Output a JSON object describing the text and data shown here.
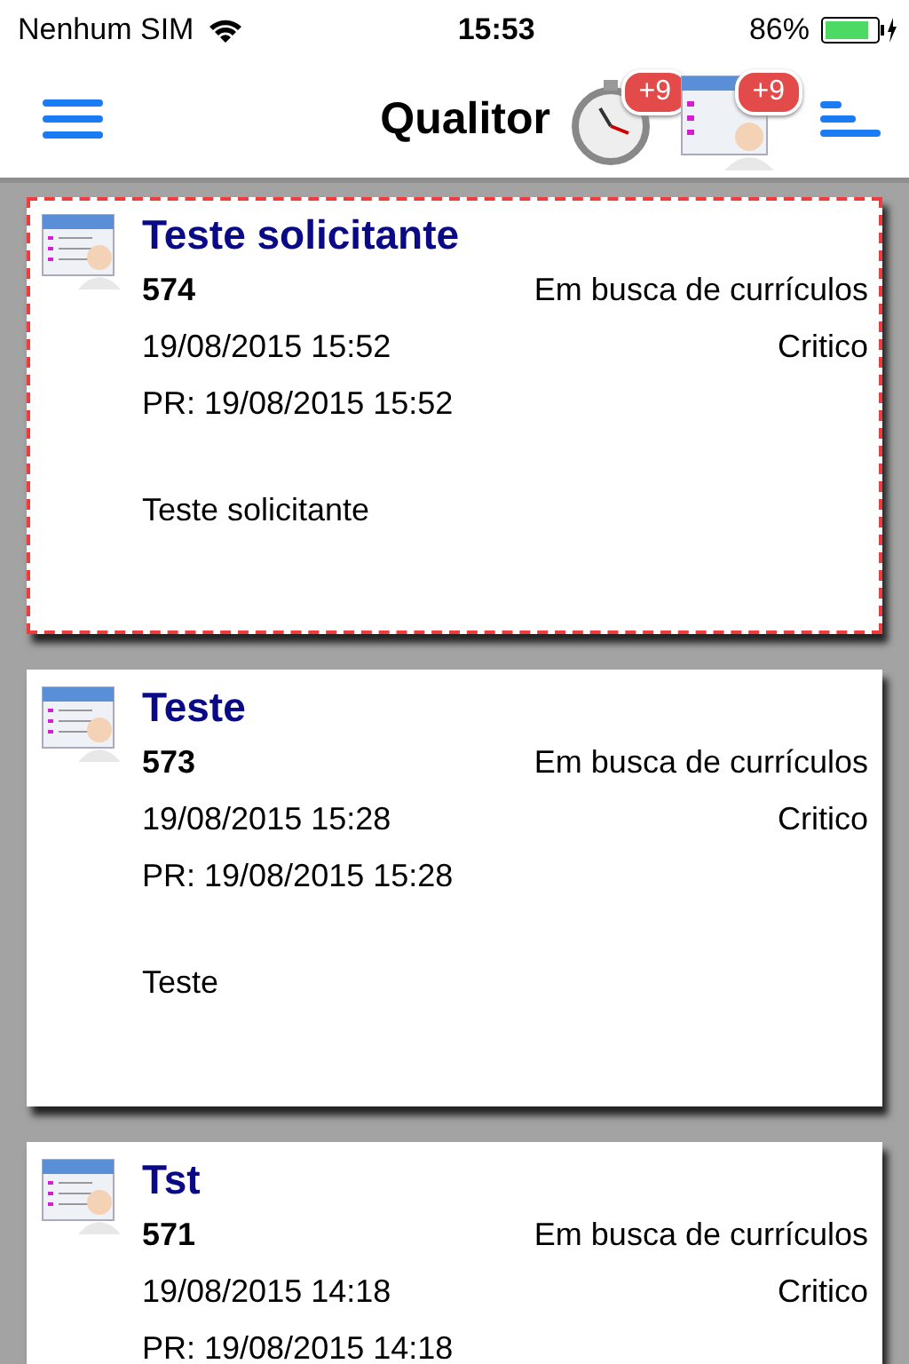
{
  "status_bar": {
    "carrier": "Nenhum SIM",
    "time": "15:53",
    "battery": {
      "text": "86%",
      "level": 0.86
    }
  },
  "nav": {
    "title": "Qualitor",
    "badges": [
      {
        "kind": "timer",
        "count": "+9"
      },
      {
        "kind": "requester",
        "count": "+9"
      }
    ]
  },
  "tickets": [
    {
      "title": "Teste solicitante",
      "number": "574",
      "status": "Em busca de currículos",
      "date": "19/08/2015 15:52",
      "priority": "Critico",
      "pr": "PR: 19/08/2015 15:52",
      "description": "Teste solicitante",
      "selected": true
    },
    {
      "title": "Teste",
      "number": "573",
      "status": "Em busca de currículos",
      "date": "19/08/2015 15:28",
      "priority": "Critico",
      "pr": "PR: 19/08/2015 15:28",
      "description": "Teste",
      "selected": false
    },
    {
      "title": "Tst",
      "number": "571",
      "status": "Em busca de currículos",
      "date": "19/08/2015 14:18",
      "priority": "Critico",
      "pr": "PR: 19/08/2015 14:18",
      "selected": false
    }
  ]
}
